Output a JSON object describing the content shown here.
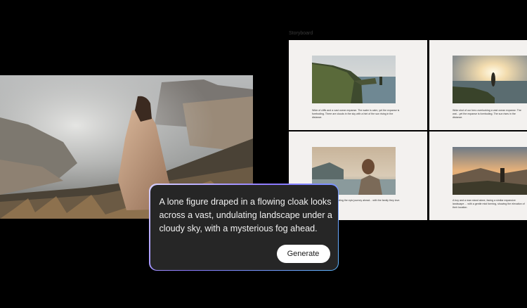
{
  "storyboard": {
    "label": "Storyboard",
    "panels": [
      {
        "caption": "Wide of cliffs and a vast ocean expanse. The water is calm, yet the expanse is foreboding. There are clouds in the sky with a hint of the sun rising in the distance."
      },
      {
        "caption": "Wide shot of our hero overlooking a vast ocean expanse. The wat... yet the expanse is foreboding. The sun rises in the distance."
      },
      {
        "caption": "...hero's face, contemplating the epic journey ahead... with the family they love."
      },
      {
        "caption": "A boy and a man stand alone, facing a similar expansive landscape ... with a gentle mist forming, showing the elevation of their location."
      }
    ]
  },
  "prompt": {
    "text": "A lone figure draped in a flowing cloak looks across a vast, undulating landscape under a cloudy sky, with a mysterious fog ahead.",
    "generate_label": "Generate"
  },
  "colors": {
    "background": "#000000",
    "card": "#f3f1ef",
    "prompt_bg": "#262626",
    "accent_purple": "#8c79ff",
    "accent_blue": "#5fb7ff"
  }
}
